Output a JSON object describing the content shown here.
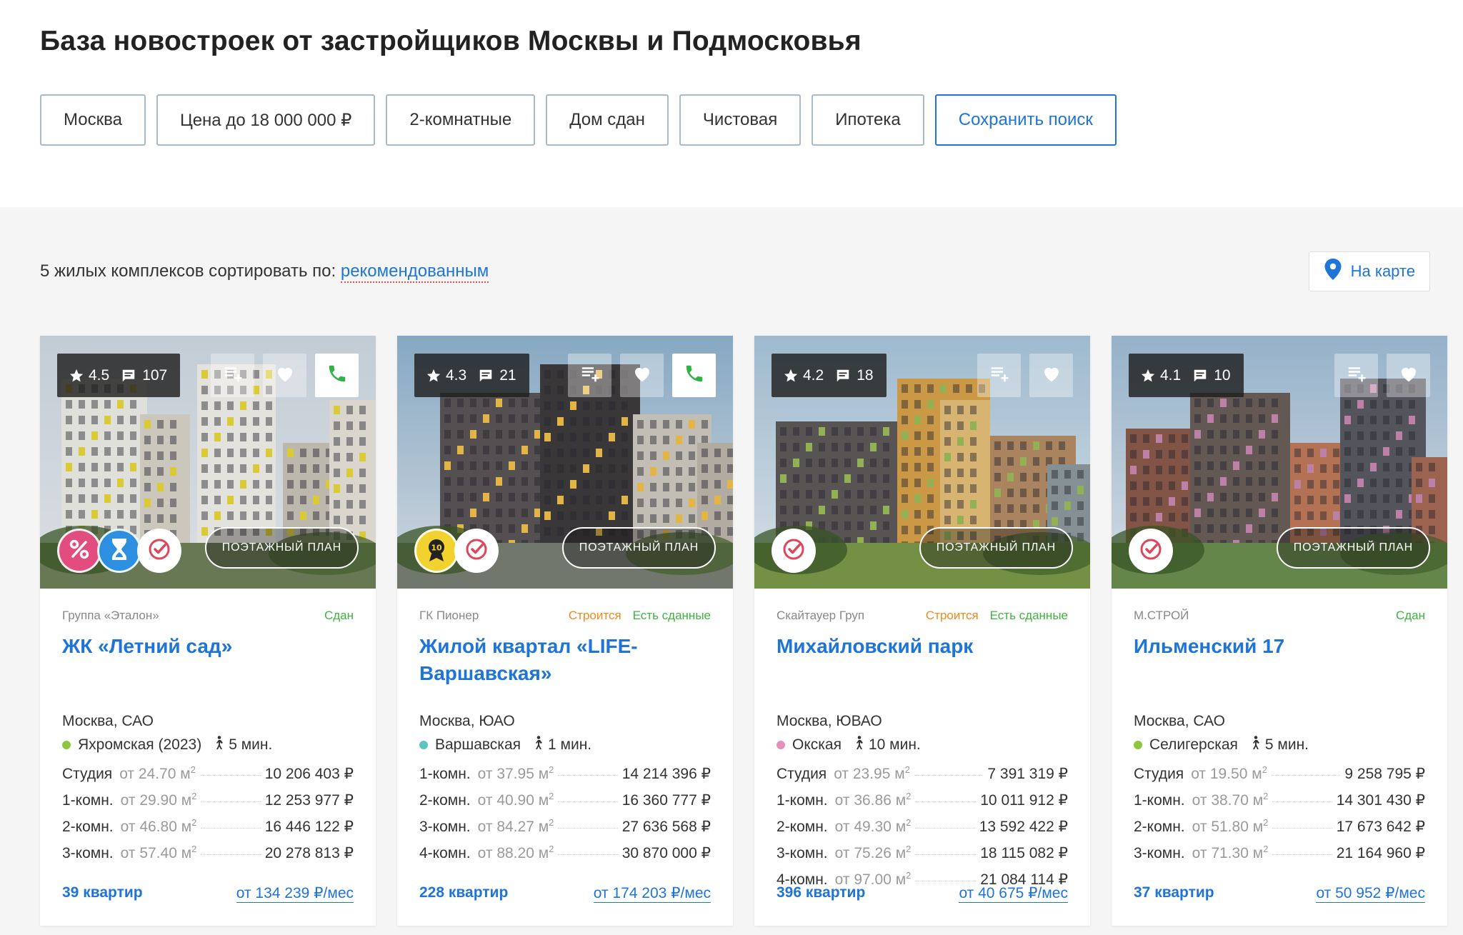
{
  "page_title": "База новостроек от застройщиков Москвы и Подмосковья",
  "filters": [
    {
      "label": "Москва"
    },
    {
      "label": "Цена до 18 000 000 ₽"
    },
    {
      "label": "2-комнатные"
    },
    {
      "label": "Дом сдан"
    },
    {
      "label": "Чистовая"
    },
    {
      "label": "Ипотека"
    }
  ],
  "save_search_label": "Сохранить поиск",
  "list": {
    "count_text": "5 жилых комплексов сортировать по: ",
    "sort_label": "рекомендованным",
    "map_label": "На карте"
  },
  "plan_label": "ПОЭТАЖНЫЙ ПЛАН",
  "colors": {
    "accent": "#1e74d7",
    "built": "#3fb33f",
    "building": "#f08a1c"
  },
  "cards": [
    {
      "rating": "4.5",
      "reviews": "107",
      "has_phone": true,
      "badges": [
        "discount-icon",
        "hourglass-icon",
        "check-shield-icon"
      ],
      "developer": "Группа «Эталон»",
      "status_building": "",
      "status_ready": "Сдан",
      "name": "ЖК «Летний сад»",
      "district": "Москва, САО",
      "metro": "Яхромская (2023)",
      "metro_color": "#8dc63f",
      "walk": "5 мин.",
      "apartments": [
        {
          "type": "Студия",
          "area": "от 24.70 м",
          "price": "10 206 403 ₽"
        },
        {
          "type": "1-комн.",
          "area": "от 29.90 м",
          "price": "12 253 977 ₽"
        },
        {
          "type": "2-комн.",
          "area": "от 46.80 м",
          "price": "16 446 122 ₽"
        },
        {
          "type": "3-комн.",
          "area": "от 57.40 м",
          "price": "20 278 813 ₽"
        }
      ],
      "apt_count": "39 квартир",
      "mortgage": "от 134 239 ₽/мес"
    },
    {
      "rating": "4.3",
      "reviews": "21",
      "has_phone": true,
      "badges": [
        "award-icon",
        "check-shield-icon"
      ],
      "developer": "ГК Пионер",
      "status_building": "Строится",
      "status_ready": "Есть сданные",
      "name": "Жилой квартал «LIFE-Варшавская»",
      "district": "Москва, ЮАО",
      "metro": "Варшавская",
      "metro_color": "#5ec4c0",
      "walk": "1 мин.",
      "apartments": [
        {
          "type": "1-комн.",
          "area": "от 37.95 м",
          "price": "14 214 396 ₽"
        },
        {
          "type": "2-комн.",
          "area": "от 40.90 м",
          "price": "16 360 777 ₽"
        },
        {
          "type": "3-комн.",
          "area": "от 84.27 м",
          "price": "27 636 568 ₽"
        },
        {
          "type": "4-комн.",
          "area": "от 88.20 м",
          "price": "30 870 000 ₽"
        }
      ],
      "apt_count": "228 квартир",
      "mortgage": "от 174 203 ₽/мес"
    },
    {
      "rating": "4.2",
      "reviews": "18",
      "has_phone": false,
      "badges": [
        "check-shield-icon"
      ],
      "developer": "Скайтауер Груп",
      "status_building": "Строится",
      "status_ready": "Есть сданные",
      "name": "Михайловский парк",
      "district": "Москва, ЮВАО",
      "metro": "Окская",
      "metro_color": "#e58fbd",
      "walk": "10 мин.",
      "apartments": [
        {
          "type": "Студия",
          "area": "от 23.95 м",
          "price": "7 391 319 ₽"
        },
        {
          "type": "1-комн.",
          "area": "от 36.86 м",
          "price": "10 011 912 ₽"
        },
        {
          "type": "2-комн.",
          "area": "от 49.30 м",
          "price": "13 592 422 ₽"
        },
        {
          "type": "3-комн.",
          "area": "от 75.26 м",
          "price": "18 115 082 ₽"
        },
        {
          "type": "4-комн.",
          "area": "от 97.00 м",
          "price": "21 084 114 ₽"
        }
      ],
      "apt_count": "396 квартир",
      "mortgage": "от 40 675 ₽/мес"
    },
    {
      "rating": "4.1",
      "reviews": "10",
      "has_phone": false,
      "badges": [
        "check-shield-icon"
      ],
      "developer": "М.СТРОЙ",
      "status_building": "",
      "status_ready": "Сдан",
      "name": "Ильменский 17",
      "district": "Москва, САО",
      "metro": "Селигерская",
      "metro_color": "#8dc63f",
      "walk": "5 мин.",
      "apartments": [
        {
          "type": "Студия",
          "area": "от 19.50 м",
          "price": "9 258 795 ₽"
        },
        {
          "type": "1-комн.",
          "area": "от 38.70 м",
          "price": "14 301 430 ₽"
        },
        {
          "type": "2-комн.",
          "area": "от 51.80 м",
          "price": "17 673 642 ₽"
        },
        {
          "type": "3-комн.",
          "area": "от 71.30 м",
          "price": "21 164 960 ₽"
        }
      ],
      "apt_count": "37 квартир",
      "mortgage": "от 50 952 ₽/мес"
    }
  ]
}
